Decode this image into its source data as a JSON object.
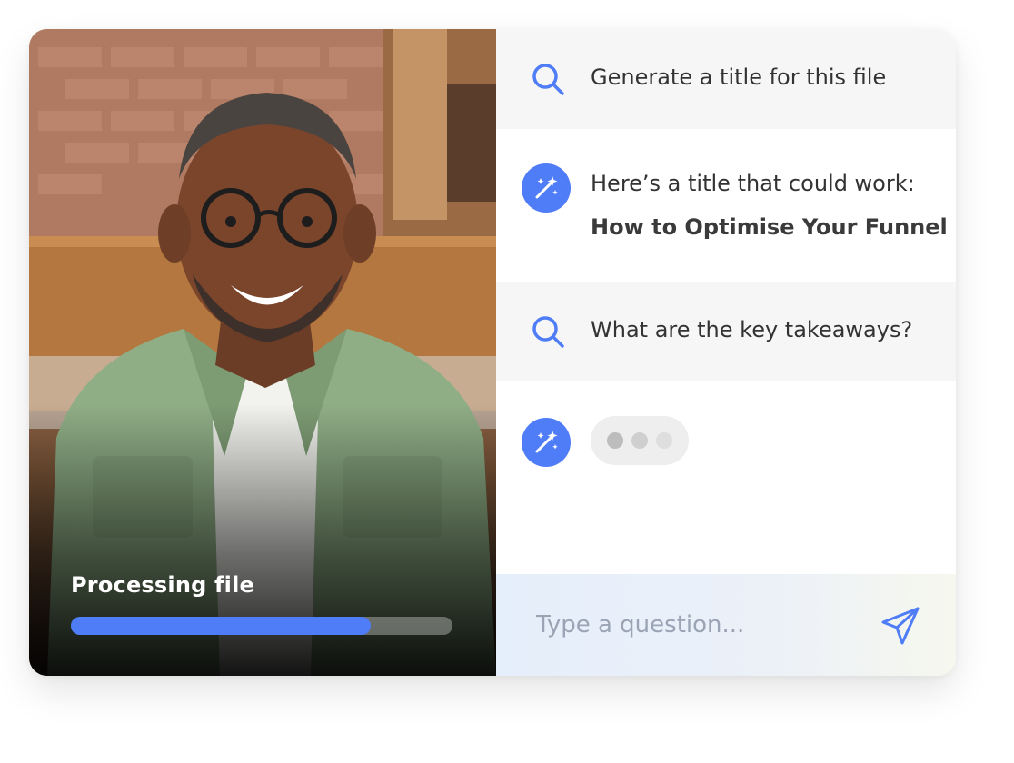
{
  "photo_panel": {
    "status_label": "Processing file",
    "progress_percent": 78.6,
    "progress_color": "#4f7cf7"
  },
  "chat": {
    "messages": [
      {
        "role": "user",
        "icon": "search-icon",
        "text": "Generate a title for this file"
      },
      {
        "role": "assistant",
        "icon": "magic-wand-icon",
        "text": "Here’s a title that could work:",
        "emphasis": "How to Optimise Your Funnel"
      },
      {
        "role": "user",
        "icon": "search-icon",
        "text": "What are the key takeaways?"
      },
      {
        "role": "assistant",
        "icon": "magic-wand-icon",
        "typing": true
      }
    ],
    "input": {
      "placeholder": "Type a question...",
      "value": ""
    },
    "send_icon": "paper-plane-icon",
    "accent_color": "#4f7cf7"
  }
}
